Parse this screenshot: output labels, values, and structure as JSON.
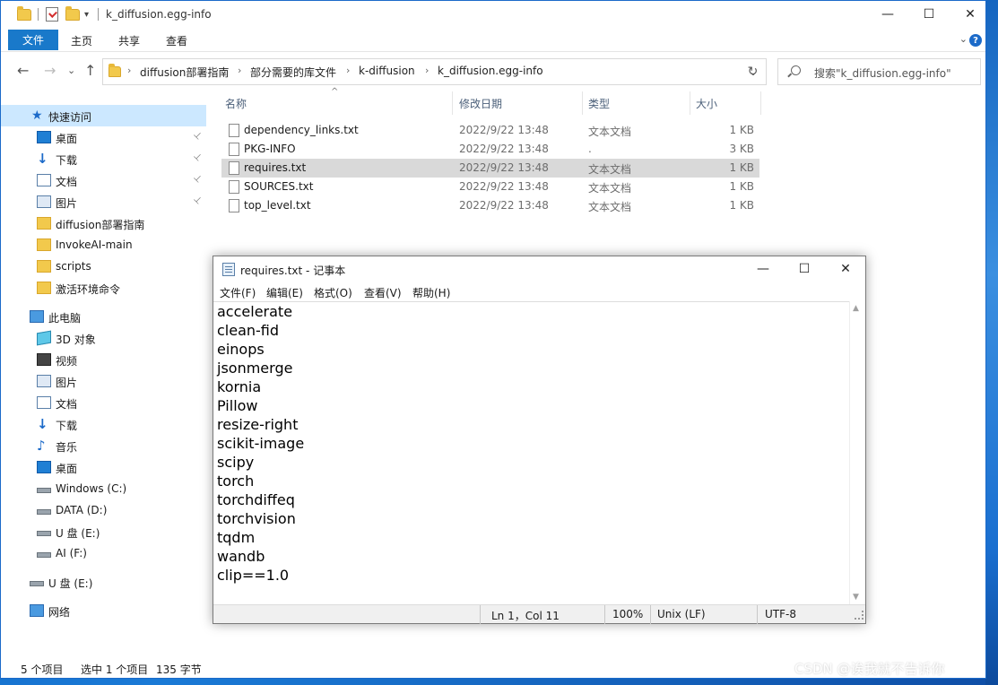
{
  "window": {
    "title": "k_diffusion.egg-info",
    "minimize": "—",
    "maximize": "☐",
    "close": "✕"
  },
  "ribbon": {
    "file": "文件",
    "home": "主页",
    "share": "共享",
    "view": "查看",
    "collapse": "⌄",
    "help": "?"
  },
  "nav": {
    "back": "←",
    "forward": "→",
    "recent": "⌄",
    "up": "↑",
    "breadcrumbs": [
      "diffusion部署指南",
      "部分需要的库文件",
      "k-diffusion",
      "k_diffusion.egg-info"
    ],
    "sep": "›",
    "dropdown": "⌄",
    "refresh": "↻",
    "search_placeholder": "搜索\"k_diffusion.egg-info\""
  },
  "sidebar": {
    "items": [
      {
        "label": "快速访问",
        "icon": "star-icon"
      },
      {
        "label": "桌面",
        "icon": "desktop-icon"
      },
      {
        "label": "下载",
        "icon": "download-icon"
      },
      {
        "label": "文档",
        "icon": "document-icon"
      },
      {
        "label": "图片",
        "icon": "picture-icon"
      },
      {
        "label": "diffusion部署指南",
        "icon": "folder-icon"
      },
      {
        "label": "InvokeAI-main",
        "icon": "folder-icon"
      },
      {
        "label": "scripts",
        "icon": "folder-icon"
      },
      {
        "label": "激活环境命令",
        "icon": "folder-icon"
      },
      {
        "label": "此电脑",
        "icon": "computer-icon"
      },
      {
        "label": "3D 对象",
        "icon": "3d-objects-icon"
      },
      {
        "label": "视频",
        "icon": "video-icon"
      },
      {
        "label": "图片",
        "icon": "picture-icon"
      },
      {
        "label": "文档",
        "icon": "document-icon"
      },
      {
        "label": "下载",
        "icon": "download-icon"
      },
      {
        "label": "音乐",
        "icon": "music-icon"
      },
      {
        "label": "桌面",
        "icon": "desktop-icon"
      },
      {
        "label": "Windows (C:)",
        "icon": "drive-icon"
      },
      {
        "label": "DATA (D:)",
        "icon": "drive-icon"
      },
      {
        "label": "U 盘 (E:)",
        "icon": "drive-icon"
      },
      {
        "label": "AI (F:)",
        "icon": "drive-icon"
      },
      {
        "label": "U 盘 (E:)",
        "icon": "drive-icon"
      },
      {
        "label": "网络",
        "icon": "network-icon"
      }
    ],
    "pin": "📌"
  },
  "columns": {
    "name": "名称",
    "modified": "修改日期",
    "type": "类型",
    "size": "大小",
    "sort_indicator": "^"
  },
  "files": [
    {
      "name": "dependency_links.txt",
      "date": "2022/9/22 13:48",
      "type": "文本文档",
      "size": "1 KB"
    },
    {
      "name": "PKG-INFO",
      "date": "2022/9/22 13:48",
      "type": ".",
      "size": "3 KB"
    },
    {
      "name": "requires.txt",
      "date": "2022/9/22 13:48",
      "type": "文本文档",
      "size": "1 KB"
    },
    {
      "name": "SOURCES.txt",
      "date": "2022/9/22 13:48",
      "type": "文本文档",
      "size": "1 KB"
    },
    {
      "name": "top_level.txt",
      "date": "2022/9/22 13:48",
      "type": "文本文档",
      "size": "1 KB"
    }
  ],
  "status": {
    "count": "5 个项目",
    "selected": "选中 1 个项目",
    "size": "135 字节"
  },
  "notepad": {
    "title": "requires.txt - 记事本",
    "minimize": "—",
    "maximize": "☐",
    "close": "✕",
    "menu": [
      "文件(F)",
      "编辑(E)",
      "格式(O)",
      "查看(V)",
      "帮助(H)"
    ],
    "lines": [
      "accelerate",
      "clean-fid",
      "einops",
      "jsonmerge",
      "kornia",
      "Pillow",
      "resize-right",
      "scikit-image",
      "scipy",
      "torch",
      "torchdiffeq",
      "torchvision",
      "tqdm",
      "wandb",
      "clip==1.0"
    ],
    "scroll_up": "▲",
    "scroll_down": "▼",
    "status": {
      "position": "Ln 1，Col 11",
      "zoom": "100%",
      "line_ending": "Unix (LF)",
      "encoding": "UTF-8"
    }
  },
  "watermark": "CSDN @诶我就不告诉你"
}
